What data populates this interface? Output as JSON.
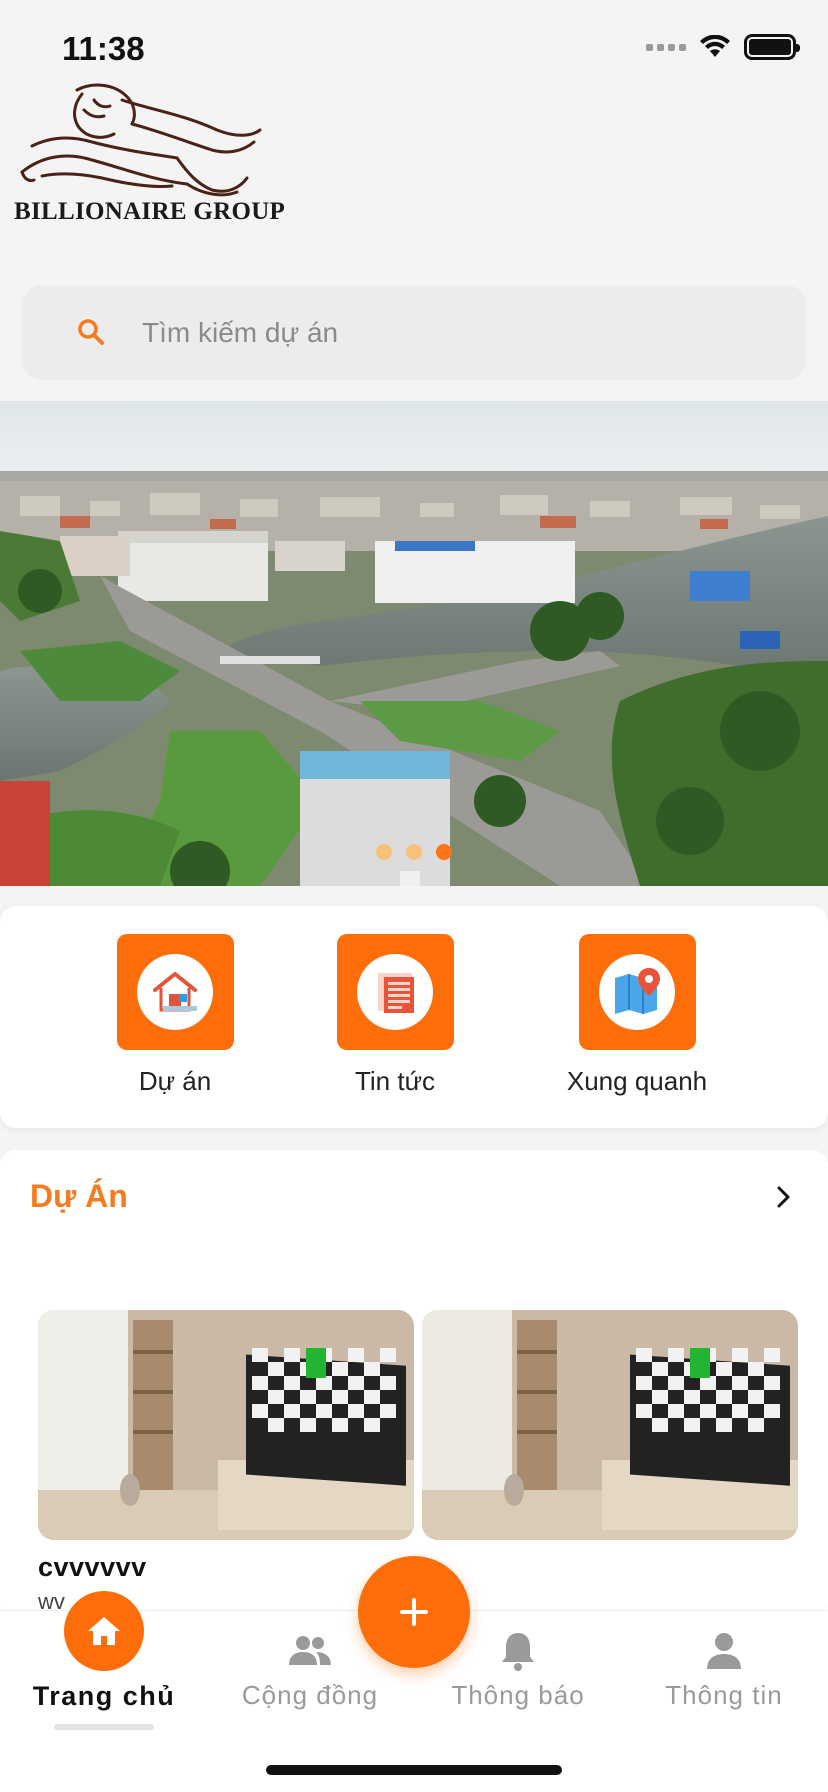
{
  "status_bar": {
    "time": "11:38"
  },
  "brand": {
    "logo_text": "BILLIONAIRE GROUP"
  },
  "search": {
    "placeholder": "Tìm kiếm dự án"
  },
  "banner": {
    "slide_count": 3,
    "active_slide": 3
  },
  "quick_actions": [
    {
      "label": "Dự án",
      "icon": "house-icon"
    },
    {
      "label": "Tin tức",
      "icon": "news-icon"
    },
    {
      "label": "Xung quanh",
      "icon": "map-pin-icon"
    }
  ],
  "projects": {
    "title": "Dự Án",
    "items": [
      {
        "name": "cvvvvvv",
        "subtitle": "wv"
      },
      {
        "name": "",
        "subtitle": ""
      }
    ]
  },
  "tab_bar": {
    "items": [
      {
        "label": "Trang chủ",
        "icon": "home-icon",
        "active": true
      },
      {
        "label": "Cộng đồng",
        "icon": "people-icon",
        "active": false
      },
      {
        "label": "Thông báo",
        "icon": "bell-icon",
        "active": false
      },
      {
        "label": "Thông tin",
        "icon": "person-icon",
        "active": false
      }
    ],
    "fab_icon": "plus-icon"
  },
  "colors": {
    "accent": "#fd6e0a",
    "title_orange": "#f47b20",
    "inactive_tab": "#9a9a9a"
  }
}
